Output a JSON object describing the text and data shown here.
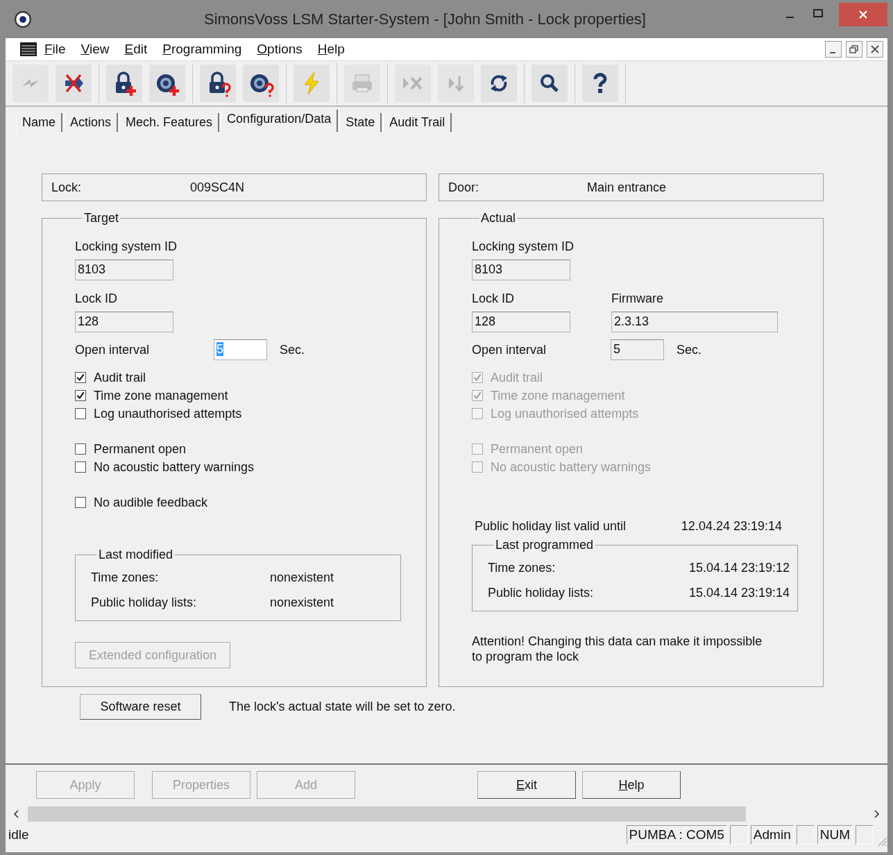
{
  "window": {
    "title": "SimonsVoss LSM Starter-System - [John Smith - Lock properties]"
  },
  "menu": [
    {
      "label": "File",
      "access_key": true
    },
    {
      "label": "View",
      "access_key": true
    },
    {
      "label": "Edit",
      "access_key": true
    },
    {
      "label": "Programming",
      "access_key": true
    },
    {
      "label": "Options",
      "access_key": true
    },
    {
      "label": "Help",
      "access_key": true
    }
  ],
  "toolbar": [
    [
      {
        "kind": "transfer",
        "disabled": true
      },
      {
        "kind": "delete",
        "disabled": false
      }
    ],
    [
      {
        "kind": "lock_add",
        "disabled": false
      },
      {
        "kind": "target_add",
        "disabled": false
      }
    ],
    [
      {
        "kind": "lock_query",
        "disabled": false
      },
      {
        "kind": "target_query",
        "disabled": false
      }
    ],
    [
      {
        "kind": "program",
        "disabled": false
      }
    ],
    [
      {
        "kind": "print",
        "disabled": true
      }
    ],
    [
      {
        "kind": "abort",
        "disabled": true
      },
      {
        "kind": "skip",
        "disabled": true
      },
      {
        "kind": "sync",
        "disabled": false
      }
    ],
    [
      {
        "kind": "search",
        "disabled": false
      }
    ],
    [
      {
        "kind": "help",
        "disabled": false
      }
    ]
  ],
  "tabs": [
    {
      "label": "Name",
      "selected": false
    },
    {
      "label": "Actions",
      "selected": false
    },
    {
      "label": "Mech. Features",
      "selected": false
    },
    {
      "label": "Configuration/Data",
      "selected": true
    },
    {
      "label": "State",
      "selected": false
    },
    {
      "label": "Audit Trail",
      "selected": false
    }
  ],
  "info": [
    {
      "label": "Lock:",
      "value": "009SC4N"
    },
    {
      "label": "Door:",
      "value": "Main entrance"
    }
  ],
  "panels": [
    {
      "title": "Target",
      "locking_system_id": {
        "label": "Locking system ID",
        "value": "8103"
      },
      "lock_id": {
        "label": "Lock ID",
        "value": "128"
      },
      "open_interval": {
        "label": "Open interval",
        "value": "5",
        "unit": "Sec.",
        "focused": true
      },
      "checkbox_groups": [
        [
          {
            "label": "Audit trail",
            "checked": true,
            "disabled": false
          },
          {
            "label": "Time zone management",
            "checked": true,
            "disabled": false
          },
          {
            "label": "Log unauthorised attempts",
            "checked": false,
            "disabled": false
          }
        ],
        [
          {
            "label": "Permanent open",
            "checked": false,
            "disabled": false
          },
          {
            "label": "No acoustic battery warnings",
            "checked": false,
            "disabled": false
          }
        ],
        [
          {
            "label": "No audible feedback",
            "checked": false,
            "disabled": false
          }
        ]
      ],
      "history": {
        "title": "Last modified",
        "rows": [
          {
            "label": "Time zones:",
            "value": "nonexistent"
          },
          {
            "label": "Public holiday lists:",
            "value": "nonexistent"
          }
        ]
      },
      "extended_button": {
        "label": "Extended configuration",
        "disabled": true
      }
    },
    {
      "title": "Actual",
      "locking_system_id": {
        "label": "Locking system ID",
        "value": "8103"
      },
      "lock_id": {
        "label": "Lock ID",
        "value": "128"
      },
      "firmware": {
        "label": "Firmware",
        "value": "2.3.13"
      },
      "open_interval": {
        "label": "Open interval",
        "value": "5",
        "unit": "Sec.",
        "focused": false
      },
      "checkbox_groups": [
        [
          {
            "label": "Audit trail",
            "checked": true,
            "disabled": true
          },
          {
            "label": "Time zone management",
            "checked": true,
            "disabled": true
          },
          {
            "label": "Log unauthorised attempts",
            "checked": false,
            "disabled": true
          }
        ],
        [
          {
            "label": "Permanent open",
            "checked": false,
            "disabled": true
          },
          {
            "label": "No acoustic battery warnings",
            "checked": false,
            "disabled": true
          }
        ]
      ],
      "holiday_valid": {
        "label": "Public holiday list valid until",
        "value": "12.04.24 23:19:14"
      },
      "history": {
        "title": "Last programmed",
        "rows": [
          {
            "label": "Time zones:",
            "value": "15.04.14 23:19:12"
          },
          {
            "label": "Public holiday lists:",
            "value": "15.04.14 23:19:14"
          }
        ]
      },
      "note": "Attention! Changing this data can make it impossible to program the lock"
    }
  ],
  "software_reset": {
    "button": "Software reset",
    "note": "The lock's actual state will be set to zero."
  },
  "bottom_buttons": [
    [
      {
        "label": "Apply",
        "disabled": true
      },
      {
        "label": "Properties",
        "disabled": true
      },
      {
        "label": "Add",
        "disabled": true
      }
    ],
    [
      {
        "label": "Exit",
        "disabled": false,
        "access_key": true
      },
      {
        "label": "Help",
        "disabled": false,
        "access_key": true
      }
    ]
  ],
  "status_bar": {
    "text": "idle",
    "panes": [
      "PUMBA : COM5",
      "Admin",
      "NUM"
    ]
  }
}
